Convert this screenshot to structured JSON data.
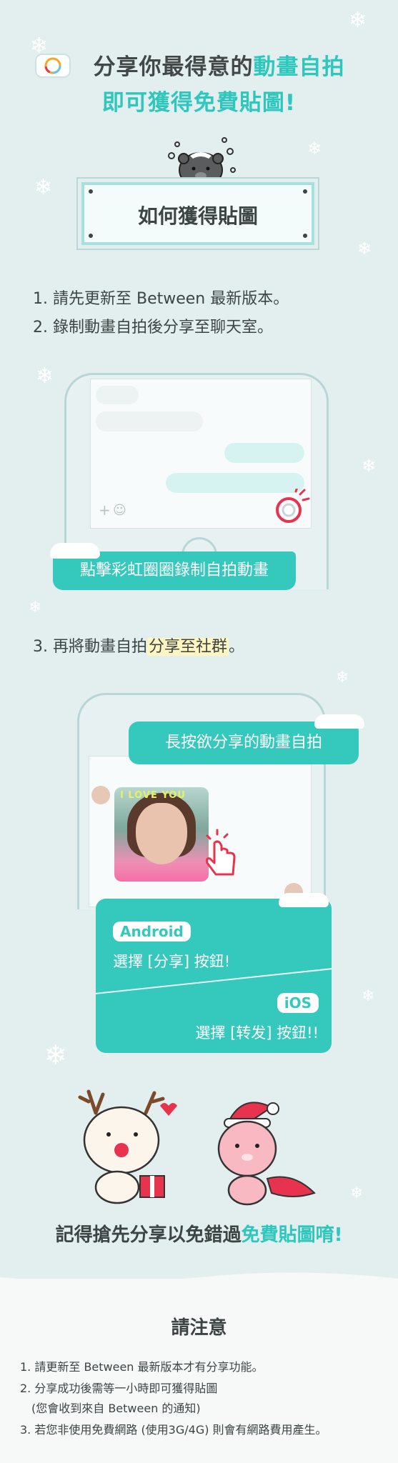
{
  "header": {
    "line1_prefix": "分享你最得意的",
    "line1_highlight": "動畫自拍",
    "line2": "即可獲得免費貼圖!"
  },
  "howto": {
    "title": "如何獲得貼圖"
  },
  "steps": [
    "1. 請先更新至 Between 最新版本。",
    "2. 錄制動畫自拍後分享至聊天室。"
  ],
  "phone1": {
    "banner": "點擊彩虹圈圈錄制自拍動畫"
  },
  "step3": {
    "prefix": "3. 再將動畫自拍",
    "highlight": "分享至社群",
    "suffix": "。"
  },
  "phone2": {
    "banner": "長按欲分享的動畫自拍",
    "photo_text": "I LOVE YOU",
    "android_label": "Android",
    "android_text": "選擇 [分享] 按鈕!",
    "ios_label": "iOS",
    "ios_text": "選擇 [转发] 按鈕!!"
  },
  "closing": {
    "prefix": "記得搶先分享以免錯過",
    "highlight": "免費貼圖唷!"
  },
  "notice": {
    "title": "請注意",
    "items": [
      "1. 請更新至 Between 最新版本才有分享功能。",
      "2. 分享成功後需等一小時即可獲得貼圖",
      "(您會收到來自 Between 的通知)",
      "3. 若您非使用免費網路 (使用3G/4G) 則會有網路費用產生。"
    ]
  },
  "colors": {
    "accent": "#2ec7bd",
    "background": "#e3eeee",
    "text": "#3d4444",
    "record_red": "#e8334f"
  },
  "icons": [
    "camera-icon",
    "snowflake-icon",
    "bear-sticker",
    "record-icon",
    "tap-hand-icon",
    "reindeer-sticker",
    "santa-sticker"
  ]
}
